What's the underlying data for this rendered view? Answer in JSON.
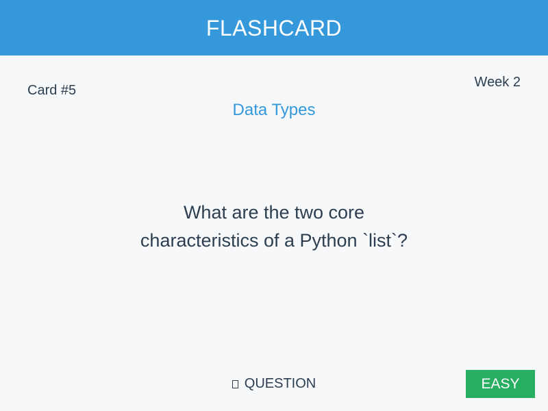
{
  "header": {
    "title": "FLASHCARD"
  },
  "card": {
    "number_label": "Card #5",
    "week_label": "Week 2",
    "topic": "Data Types",
    "question_lines": [
      "What are the two core",
      "characteristics of a Python `list`?"
    ]
  },
  "footer": {
    "mode_icon": "card-icon",
    "mode_label": "QUESTION",
    "difficulty_label": "EASY"
  },
  "colors": {
    "header": "#3498db",
    "background": "#f6f8fa",
    "text": "#2c3e50",
    "topic": "#3498db",
    "easy": "#27ae60"
  }
}
